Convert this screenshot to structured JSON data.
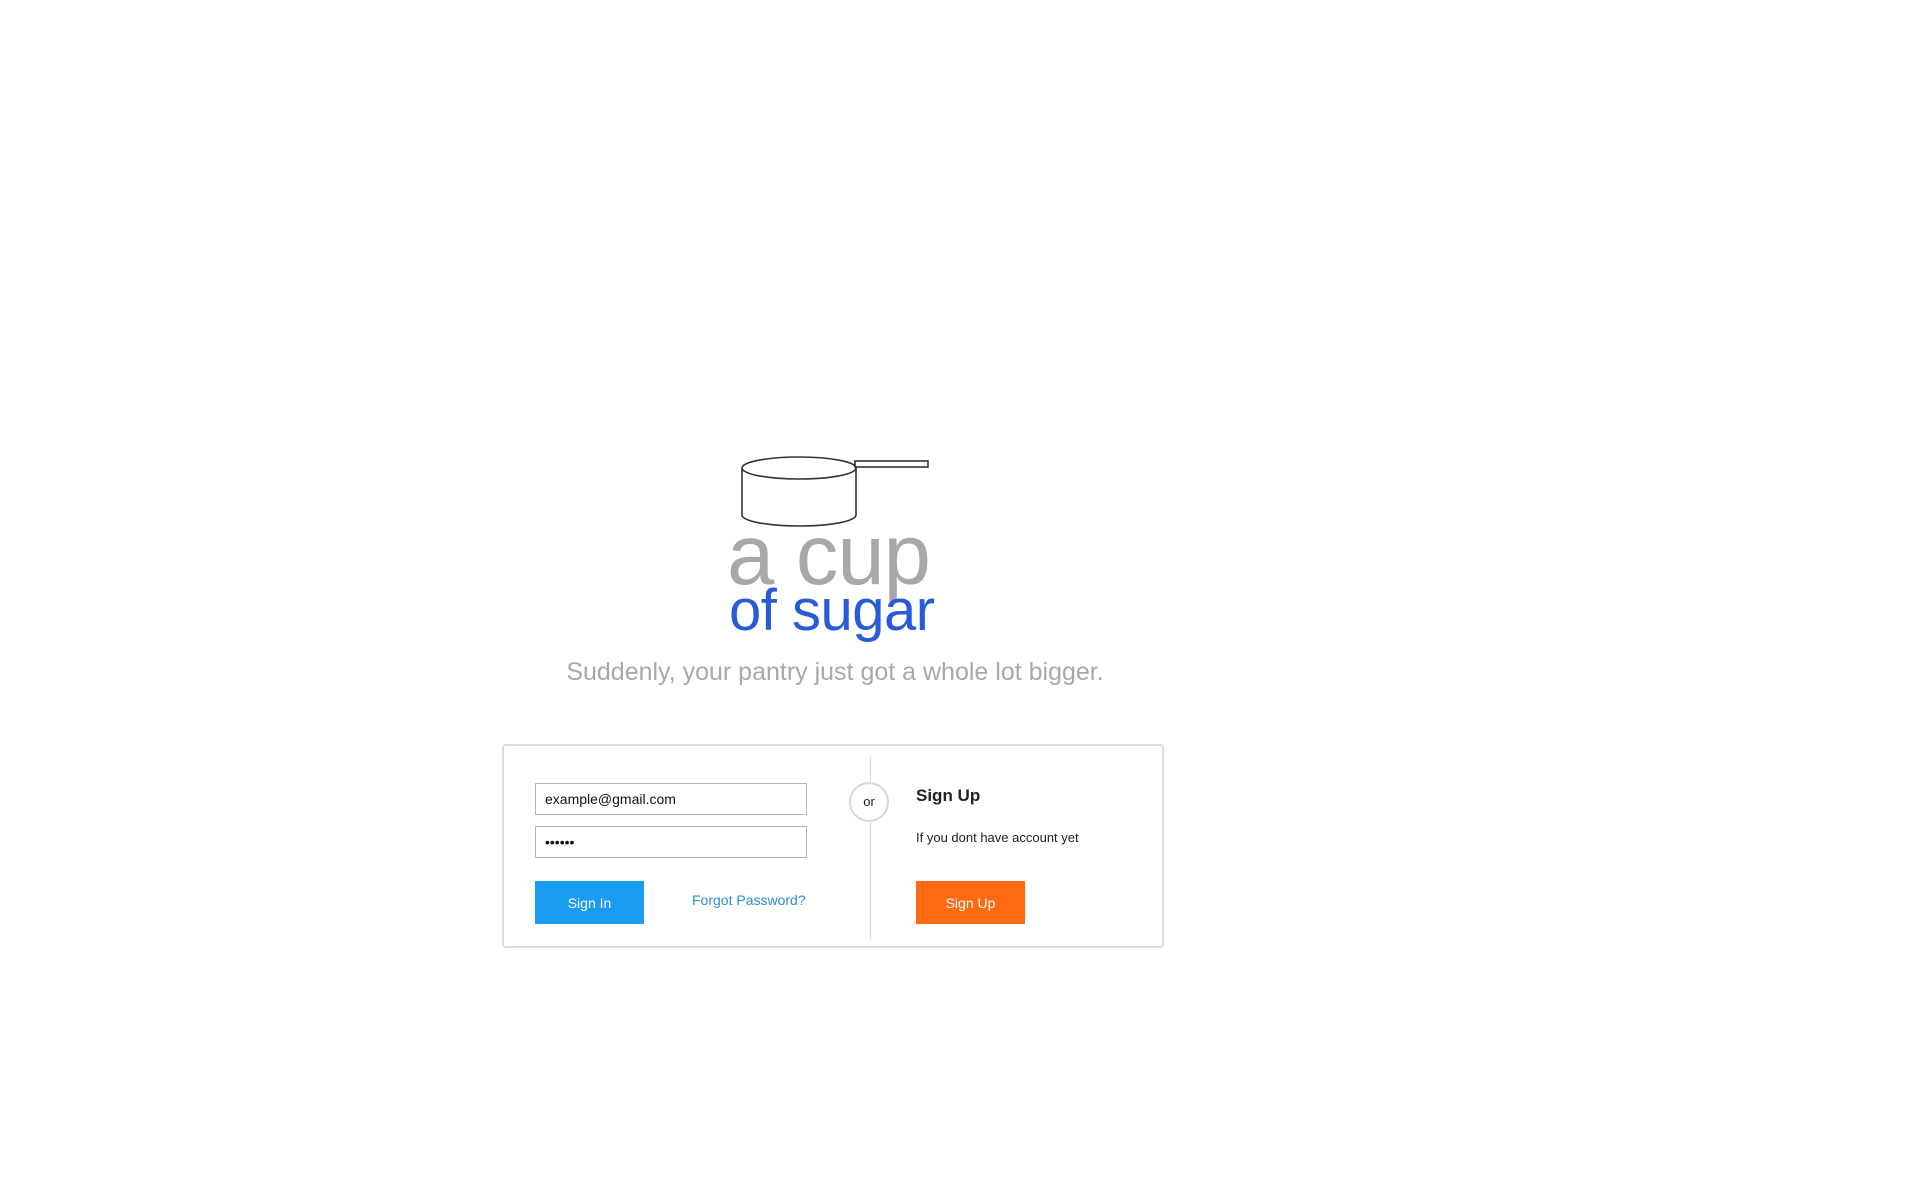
{
  "logo": {
    "line1": "a cup",
    "line2": "of sugar",
    "icon": "measuring-cup-icon",
    "colors": {
      "line1": "#a8a8a8",
      "line2": "#2a5bd7"
    }
  },
  "tagline": "Suddenly, your pantry just got a whole lot bigger.",
  "signin": {
    "email_value": "example@gmail.com",
    "password_value": "••••••",
    "button_label": "Sign In",
    "forgot_label": "Forgot Password?",
    "button_color": "#1a9cf2"
  },
  "separator": {
    "label": "or"
  },
  "signup": {
    "title": "Sign Up",
    "description": "If you dont have account yet",
    "button_label": "Sign Up",
    "button_color": "#fd6a12"
  }
}
